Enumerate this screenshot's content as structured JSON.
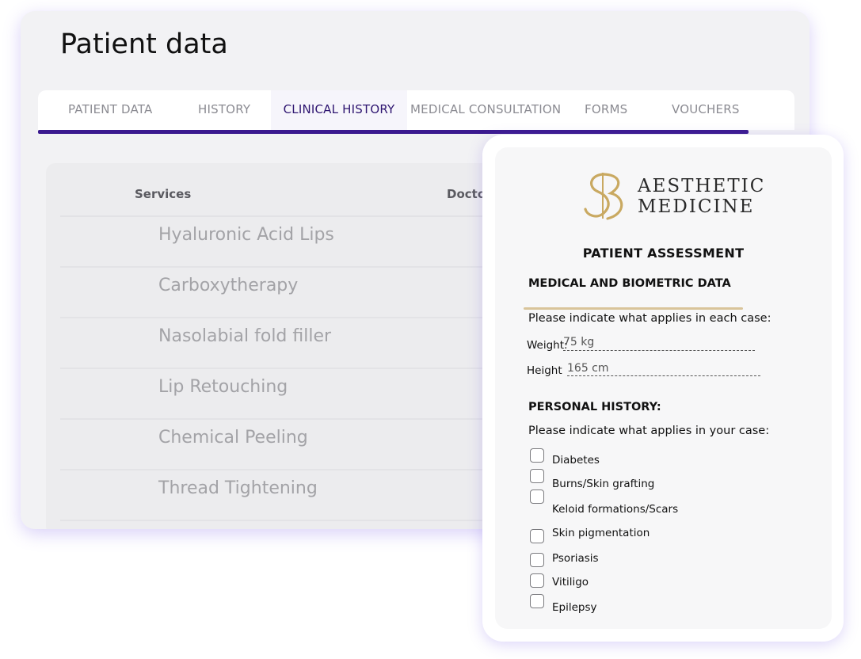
{
  "page": {
    "title": "Patient data",
    "tabs": [
      {
        "label": "PATIENT DATA"
      },
      {
        "label": "HISTORY"
      },
      {
        "label": "CLINICAL HISTORY",
        "active": true
      },
      {
        "label": "MEDICAL CONSULTATION"
      },
      {
        "label": "FORMS"
      },
      {
        "label": "VOUCHERS"
      }
    ],
    "accent": "#3b1a8f"
  },
  "table": {
    "columns": [
      "Services",
      "Docto"
    ],
    "rows": [
      "Hyaluronic Acid Lips",
      "Carboxytherapy",
      "Nasolabial fold filler",
      "Lip Retouching",
      "Chemical Peeling",
      "Thread Tightening"
    ]
  },
  "form": {
    "brand": {
      "line1": "AESTHETIC",
      "line2": "MEDICINE",
      "gold": "#c9a961"
    },
    "title": "PATIENT ASSESSMENT",
    "biometric": {
      "heading": "MEDICAL AND BIOMETRIC DATA",
      "instruction": "Please indicate what applies in each case:",
      "weight_label": "Weight:",
      "weight_value": "75 kg",
      "height_label": "Height",
      "height_value": "165 cm"
    },
    "history": {
      "heading": "PERSONAL HISTORY:",
      "instruction": "Please indicate what applies in your case:",
      "items": [
        "Diabetes",
        "Burns/Skin grafting",
        "Keloid formations/Scars",
        "Skin pigmentation",
        "Psoriasis",
        "Vitiligo",
        "Epilepsy"
      ]
    }
  }
}
